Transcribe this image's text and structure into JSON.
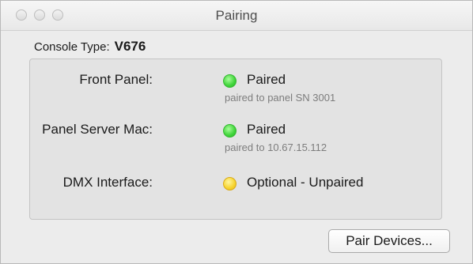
{
  "window": {
    "title": "Pairing"
  },
  "console": {
    "label": "Console Type:",
    "value": "V676"
  },
  "devices": [
    {
      "label": "Front Panel:",
      "status": "Paired",
      "status_color": "#3fd43a",
      "detail": "paired to panel SN 3001"
    },
    {
      "label": "Panel Server Mac:",
      "status": "Paired",
      "status_color": "#3fd43a",
      "detail": "paired to 10.67.15.112"
    },
    {
      "label": "DMX Interface:",
      "status": "Optional - Unpaired",
      "status_color": "#f6d32c",
      "detail": ""
    }
  ],
  "actions": {
    "pair_devices_label": "Pair Devices..."
  }
}
